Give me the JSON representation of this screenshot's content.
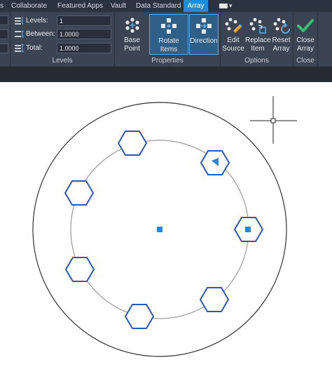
{
  "tabs": [
    {
      "label": "s",
      "active": false
    },
    {
      "label": "Collaborate",
      "active": false
    },
    {
      "label": "Featured Apps",
      "active": false
    },
    {
      "label": "Vault",
      "active": false
    },
    {
      "label": "Data Standard",
      "active": false
    },
    {
      "label": "Array",
      "active": true
    }
  ],
  "levels_panel": {
    "title": "Levels",
    "levels_label": "Levels:",
    "levels_value": "1",
    "between_label": "Between:",
    "between_value": "1.0000",
    "total_label": "Total:",
    "total_value": "1.0000"
  },
  "properties_panel": {
    "title": "Properties",
    "base_point": "Base Point",
    "rotate_items": "Rotate Items",
    "direction": "Direction"
  },
  "options_panel": {
    "title": "Options",
    "edit_source_line1": "Edit",
    "edit_source_line2": "Source",
    "replace_item_line1": "Replace",
    "replace_item_line2": "Item",
    "reset_array_line1": "Reset",
    "reset_array_line2": "Array"
  },
  "close_panel": {
    "title": "Close",
    "close_array_line1": "Close",
    "close_array_line2": "Array"
  },
  "colors": {
    "ribbon_bg": "#3b4453",
    "active_tab": "#1a8fd8",
    "grip_blue": "#1e88e5",
    "hexagon_stroke": "#2a57b8",
    "accept_green": "#38c172"
  },
  "icons": {
    "levels": "levels-icon",
    "between": "between-icon",
    "total": "total-icon",
    "base_point": "base-point-icon",
    "rotate_items": "rotate-items-icon",
    "direction": "direction-icon",
    "edit_source": "edit-source-icon",
    "replace_item": "replace-item-icon",
    "reset_array": "reset-array-icon",
    "close_array": "checkmark-icon"
  }
}
